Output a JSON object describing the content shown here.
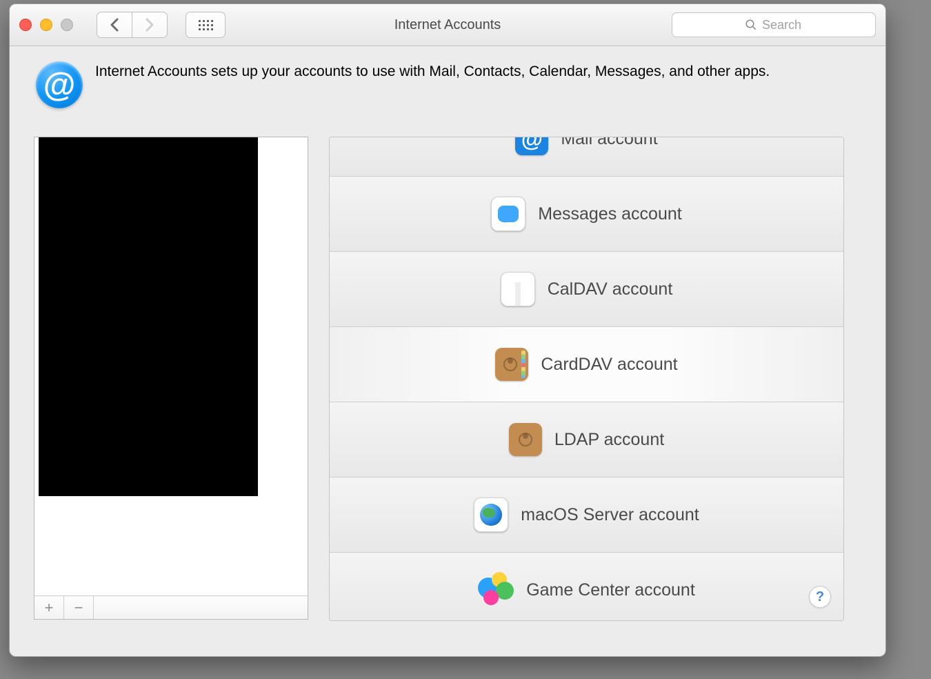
{
  "window": {
    "title": "Internet Accounts"
  },
  "toolbar": {
    "back_disabled": false,
    "forward_disabled": true,
    "search_placeholder": "Search"
  },
  "intro": {
    "icon_char": "@",
    "text": "Internet Accounts sets up your accounts to use with Mail, Contacts, Calendar, Messages, and other apps."
  },
  "accounts_pane": {
    "add_label": "+",
    "remove_label": "−"
  },
  "providers": [
    {
      "id": "mail",
      "label": "Mail account",
      "icon": "mail"
    },
    {
      "id": "messages",
      "label": "Messages account",
      "icon": "messages"
    },
    {
      "id": "caldav",
      "label": "CalDAV account",
      "icon": "calendar"
    },
    {
      "id": "carddav",
      "label": "CardDAV account",
      "icon": "contacts"
    },
    {
      "id": "ldap",
      "label": "LDAP account",
      "icon": "ldap"
    },
    {
      "id": "server",
      "label": "macOS Server account",
      "icon": "server"
    },
    {
      "id": "gamectr",
      "label": "Game Center account",
      "icon": "gamecenter"
    }
  ],
  "help_char": "?"
}
